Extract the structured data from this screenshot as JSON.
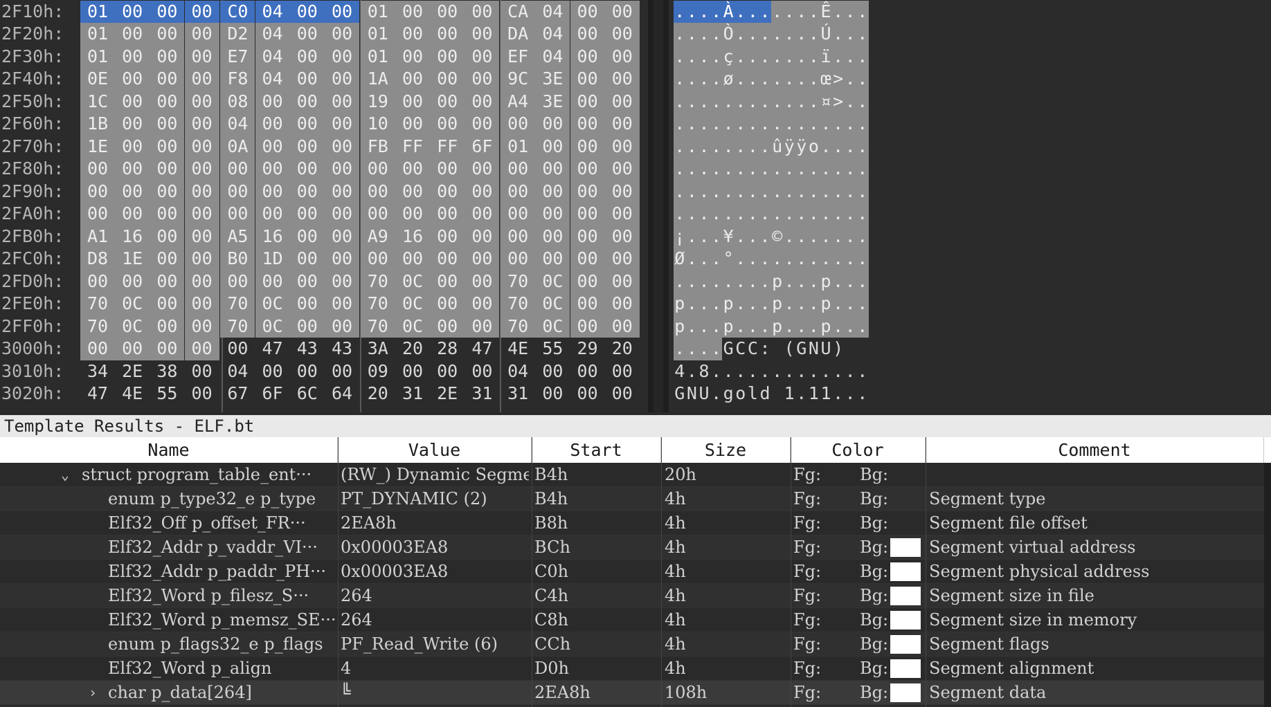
{
  "hex_editor": {
    "rows": [
      {
        "addr": "2F10h:",
        "bytes": [
          "01",
          "00",
          "00",
          "00",
          "C0",
          "04",
          "00",
          "00",
          "01",
          "00",
          "00",
          "00",
          "CA",
          "04",
          "00",
          "00"
        ],
        "ascii": "....À.......Ê..."
      },
      {
        "addr": "2F20h:",
        "bytes": [
          "01",
          "00",
          "00",
          "00",
          "D2",
          "04",
          "00",
          "00",
          "01",
          "00",
          "00",
          "00",
          "DA",
          "04",
          "00",
          "00"
        ],
        "ascii": "....Ò.......Ú..."
      },
      {
        "addr": "2F30h:",
        "bytes": [
          "01",
          "00",
          "00",
          "00",
          "E7",
          "04",
          "00",
          "00",
          "01",
          "00",
          "00",
          "00",
          "EF",
          "04",
          "00",
          "00"
        ],
        "ascii": "....ç.......ï..."
      },
      {
        "addr": "2F40h:",
        "bytes": [
          "0E",
          "00",
          "00",
          "00",
          "F8",
          "04",
          "00",
          "00",
          "1A",
          "00",
          "00",
          "00",
          "9C",
          "3E",
          "00",
          "00"
        ],
        "ascii": "....ø.......œ>.."
      },
      {
        "addr": "2F50h:",
        "bytes": [
          "1C",
          "00",
          "00",
          "00",
          "08",
          "00",
          "00",
          "00",
          "19",
          "00",
          "00",
          "00",
          "A4",
          "3E",
          "00",
          "00"
        ],
        "ascii": "............¤>.."
      },
      {
        "addr": "2F60h:",
        "bytes": [
          "1B",
          "00",
          "00",
          "00",
          "04",
          "00",
          "00",
          "00",
          "10",
          "00",
          "00",
          "00",
          "00",
          "00",
          "00",
          "00"
        ],
        "ascii": "................"
      },
      {
        "addr": "2F70h:",
        "bytes": [
          "1E",
          "00",
          "00",
          "00",
          "0A",
          "00",
          "00",
          "00",
          "FB",
          "FF",
          "FF",
          "6F",
          "01",
          "00",
          "00",
          "00"
        ],
        "ascii": "........ûÿÿo...."
      },
      {
        "addr": "2F80h:",
        "bytes": [
          "00",
          "00",
          "00",
          "00",
          "00",
          "00",
          "00",
          "00",
          "00",
          "00",
          "00",
          "00",
          "00",
          "00",
          "00",
          "00"
        ],
        "ascii": "................"
      },
      {
        "addr": "2F90h:",
        "bytes": [
          "00",
          "00",
          "00",
          "00",
          "00",
          "00",
          "00",
          "00",
          "00",
          "00",
          "00",
          "00",
          "00",
          "00",
          "00",
          "00"
        ],
        "ascii": "................"
      },
      {
        "addr": "2FA0h:",
        "bytes": [
          "00",
          "00",
          "00",
          "00",
          "00",
          "00",
          "00",
          "00",
          "00",
          "00",
          "00",
          "00",
          "00",
          "00",
          "00",
          "00"
        ],
        "ascii": "................"
      },
      {
        "addr": "2FB0h:",
        "bytes": [
          "A1",
          "16",
          "00",
          "00",
          "A5",
          "16",
          "00",
          "00",
          "A9",
          "16",
          "00",
          "00",
          "00",
          "00",
          "00",
          "00"
        ],
        "ascii": "¡...¥...©......."
      },
      {
        "addr": "2FC0h:",
        "bytes": [
          "D8",
          "1E",
          "00",
          "00",
          "B0",
          "1D",
          "00",
          "00",
          "00",
          "00",
          "00",
          "00",
          "00",
          "00",
          "00",
          "00"
        ],
        "ascii": "Ø...°..........."
      },
      {
        "addr": "2FD0h:",
        "bytes": [
          "00",
          "00",
          "00",
          "00",
          "00",
          "00",
          "00",
          "00",
          "70",
          "0C",
          "00",
          "00",
          "70",
          "0C",
          "00",
          "00"
        ],
        "ascii": "........p...p..."
      },
      {
        "addr": "2FE0h:",
        "bytes": [
          "70",
          "0C",
          "00",
          "00",
          "70",
          "0C",
          "00",
          "00",
          "70",
          "0C",
          "00",
          "00",
          "70",
          "0C",
          "00",
          "00"
        ],
        "ascii": "p...p...p...p..."
      },
      {
        "addr": "2FF0h:",
        "bytes": [
          "70",
          "0C",
          "00",
          "00",
          "70",
          "0C",
          "00",
          "00",
          "70",
          "0C",
          "00",
          "00",
          "70",
          "0C",
          "00",
          "00"
        ],
        "ascii": "p...p...p...p..."
      },
      {
        "addr": "3000h:",
        "bytes": [
          "00",
          "00",
          "00",
          "00",
          "00",
          "47",
          "43",
          "43",
          "3A",
          "20",
          "28",
          "47",
          "4E",
          "55",
          "29",
          "20"
        ],
        "ascii": "....GCC: (GNU) "
      },
      {
        "addr": "3010h:",
        "bytes": [
          "34",
          "2E",
          "38",
          "00",
          "04",
          "00",
          "00",
          "00",
          "09",
          "00",
          "00",
          "00",
          "04",
          "00",
          "00",
          "00"
        ],
        "ascii": "4.8............."
      },
      {
        "addr": "3020h:",
        "bytes": [
          "47",
          "4E",
          "55",
          "00",
          "67",
          "6F",
          "6C",
          "64",
          "20",
          "31",
          "2E",
          "31",
          "31",
          "00",
          "00",
          "00"
        ],
        "ascii": "GNU.gold 1.11..."
      }
    ],
    "highlight": {
      "selected_row": 0,
      "selected_bytes": 8,
      "shaded_through_row": 15,
      "shaded_last_row_bytes": 4
    }
  },
  "template_results": {
    "title": "Template Results - ELF.bt",
    "columns": [
      "Name",
      "Value",
      "Start",
      "Size",
      "Color",
      "Comment"
    ],
    "rows": [
      {
        "expand": "v",
        "name": "struct program_table_ent···",
        "value": "(RW_) Dynamic Segment",
        "start": "B4h",
        "size": "20h",
        "fg": "Fg:",
        "bg": "Bg:",
        "swatch": false,
        "comment": ""
      },
      {
        "expand": "",
        "name": "enum p_type32_e p_type",
        "value": "PT_DYNAMIC (2)",
        "start": "B4h",
        "size": "4h",
        "fg": "Fg:",
        "bg": "Bg:",
        "swatch": false,
        "comment": "Segment type"
      },
      {
        "expand": "",
        "name": "Elf32_Off p_offset_FR···",
        "value": "2EA8h",
        "start": "B8h",
        "size": "4h",
        "fg": "Fg:",
        "bg": "Bg:",
        "swatch": false,
        "comment": "Segment file offset"
      },
      {
        "expand": "",
        "name": "Elf32_Addr p_vaddr_VI···",
        "value": "0x00003EA8",
        "start": "BCh",
        "size": "4h",
        "fg": "Fg:",
        "bg": "Bg:",
        "swatch": true,
        "comment": "Segment virtual address"
      },
      {
        "expand": "",
        "name": "Elf32_Addr p_paddr_PH···",
        "value": "0x00003EA8",
        "start": "C0h",
        "size": "4h",
        "fg": "Fg:",
        "bg": "Bg:",
        "swatch": true,
        "comment": "Segment physical address"
      },
      {
        "expand": "",
        "name": "Elf32_Word p_filesz_S···",
        "value": "264",
        "start": "C4h",
        "size": "4h",
        "fg": "Fg:",
        "bg": "Bg:",
        "swatch": true,
        "comment": "Segment size in file"
      },
      {
        "expand": "",
        "name": "Elf32_Word p_memsz_SE···",
        "value": "264",
        "start": "C8h",
        "size": "4h",
        "fg": "Fg:",
        "bg": "Bg:",
        "swatch": true,
        "comment": "Segment size in memory"
      },
      {
        "expand": "",
        "name": "enum p_flags32_e p_flags",
        "value": "PF_Read_Write (6)",
        "start": "CCh",
        "size": "4h",
        "fg": "Fg:",
        "bg": "Bg:",
        "swatch": true,
        "comment": "Segment flags"
      },
      {
        "expand": "",
        "name": "Elf32_Word p_align",
        "value": "4",
        "start": "D0h",
        "size": "4h",
        "fg": "Fg:",
        "bg": "Bg:",
        "swatch": true,
        "comment": "Segment alignment"
      },
      {
        "expand": ">",
        "name": "char p_data[264]",
        "value": "╚",
        "start": "2EA8h",
        "size": "108h",
        "fg": "Fg:",
        "bg": "Bg:",
        "swatch": true,
        "comment": "Segment data"
      }
    ]
  },
  "colors": {
    "selection": "#3f6fbf",
    "template_highlight": "#8c8c8c",
    "background": "#2b2b2b"
  }
}
